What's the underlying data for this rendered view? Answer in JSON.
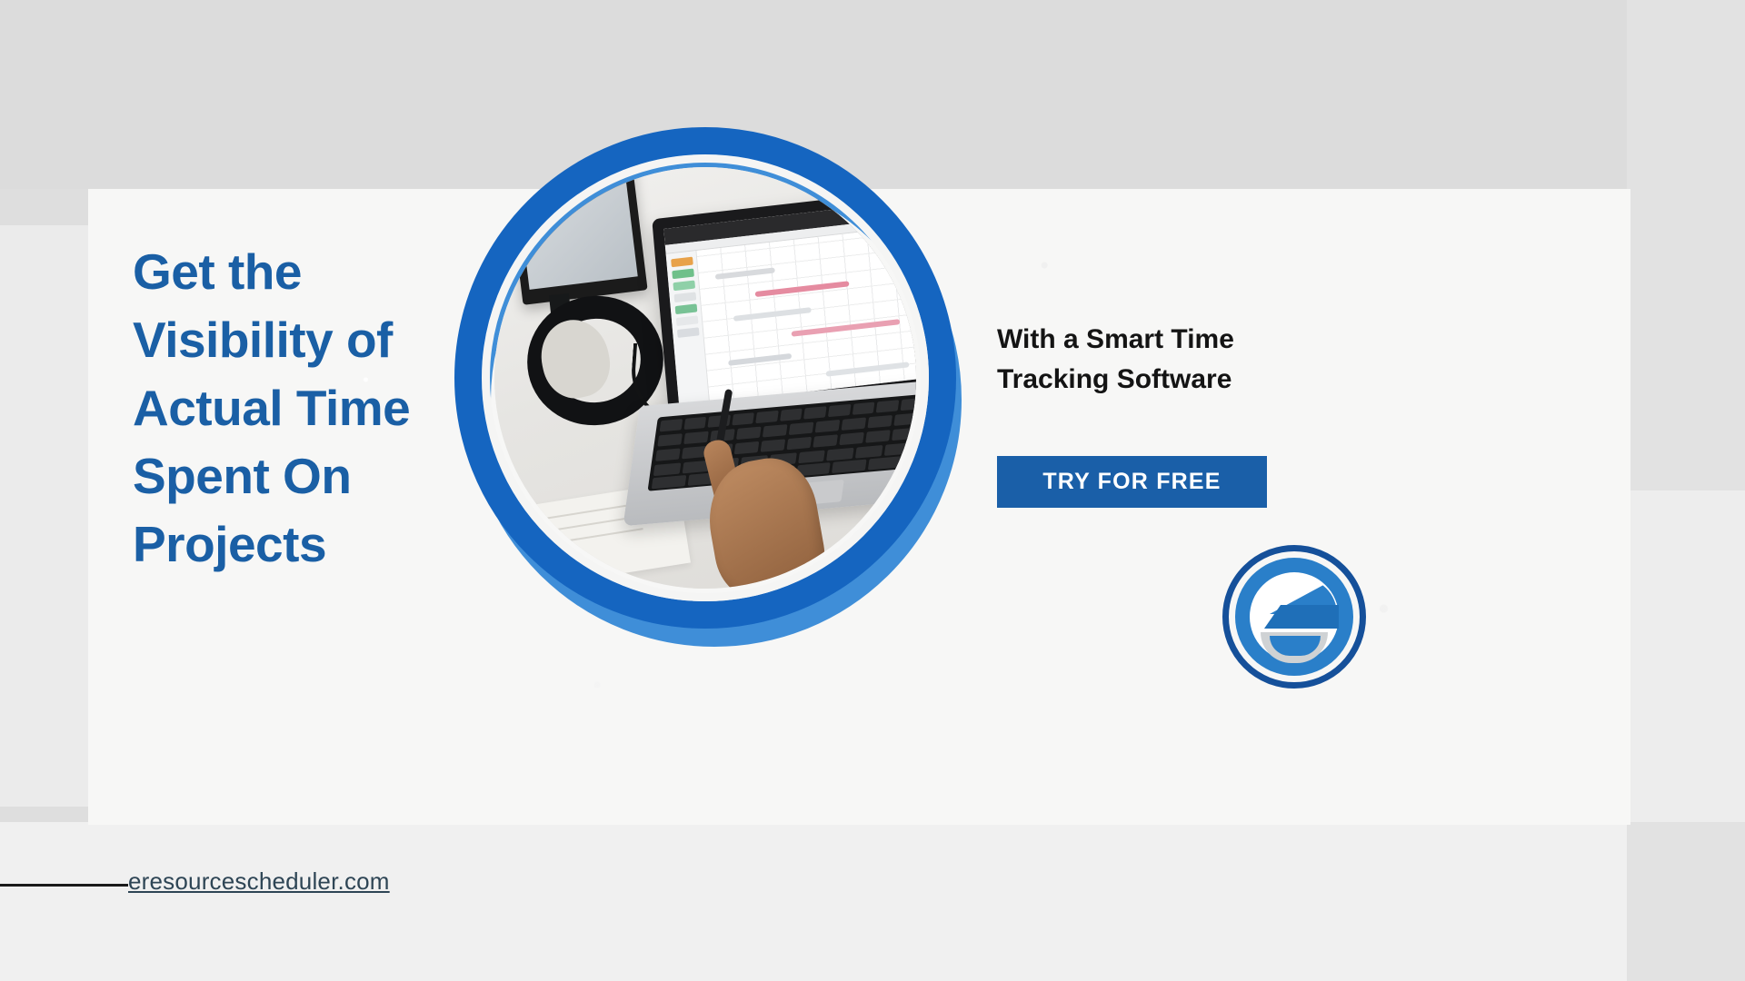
{
  "banner": {
    "headline_lines": [
      "Get the",
      "Visibility of",
      "Actual Time",
      "Spent On",
      "Projects"
    ],
    "subhead_lines": [
      "With a Smart Time",
      "Tracking Software"
    ],
    "cta_label": "TRY FOR FREE",
    "footer_url": "eresourcescheduler.com",
    "colors": {
      "headline_blue": "#1a5fa5",
      "cta_blue": "#1a5fa8",
      "ring_dark_blue": "#1565c0",
      "ring_light_blue": "#3f8ed8",
      "subhead_black": "#141414",
      "footer_slate": "#2e4555",
      "panel_white": "#f7f7f6",
      "page_gray": "#dedede"
    },
    "icons": {
      "logo": "eresource-scheduler-e-logo",
      "photo": "person-using-laptop-with-schedule-software"
    }
  }
}
